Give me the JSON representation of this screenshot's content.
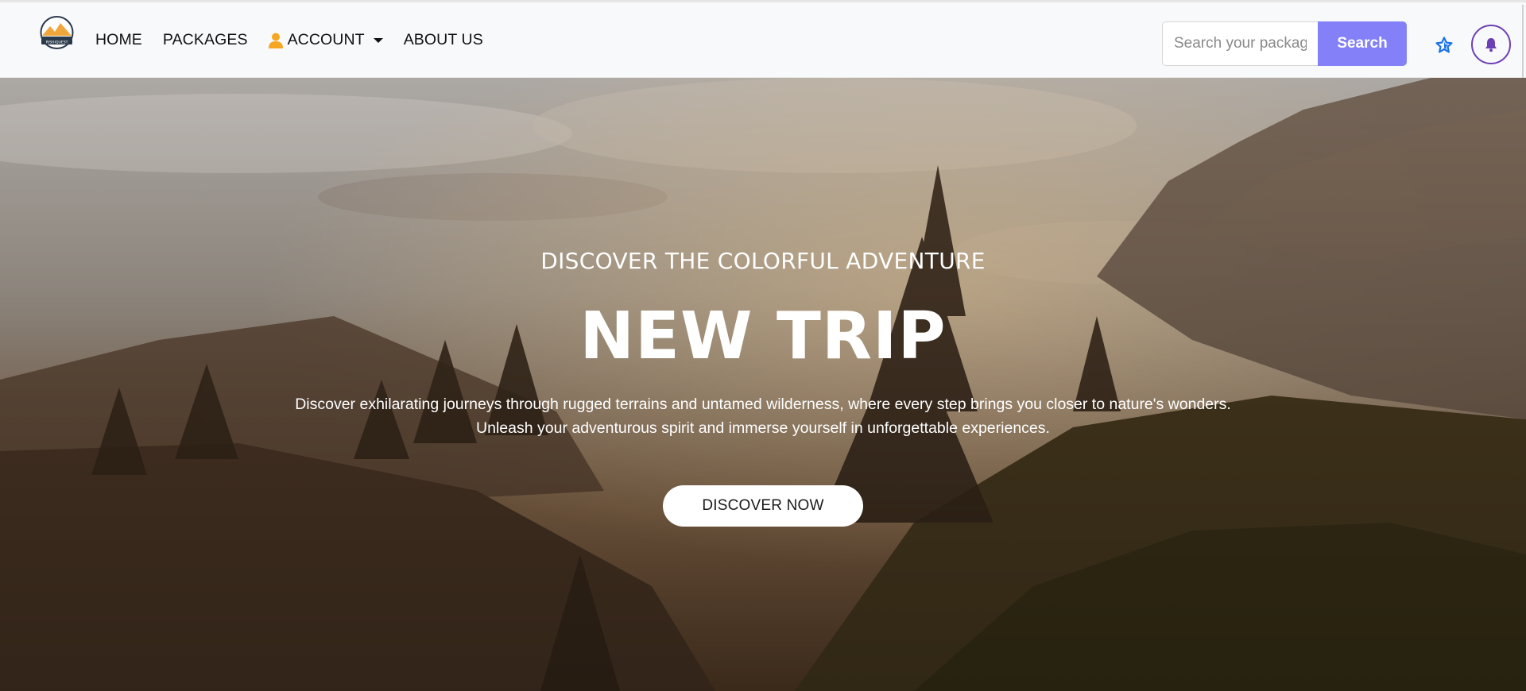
{
  "navbar": {
    "logo_text": "RISHIQUEST",
    "links": [
      "HOME",
      "PACKAGES",
      "ACCOUNT",
      "ABOUT US"
    ],
    "search": {
      "placeholder": "Search your packag",
      "button_label": "Search"
    }
  },
  "hero": {
    "subtitle": "DISCOVER THE COLORFUL ADVENTURE",
    "title": "NEW TRIP",
    "description_line1": "Discover exhilarating journeys through rugged terrains and untamed wilderness, where every step brings you closer to nature's wonders.",
    "description_line2": "Unleash your adventurous spirit and immerse yourself in unforgettable experiences.",
    "cta_label": "DISCOVER NOW"
  },
  "colors": {
    "accent": "#8481f8",
    "account_icon": "#f5a623",
    "star_icon": "#1a73e8",
    "bell": "#6d3fb5"
  },
  "icons": [
    "logo",
    "user-icon",
    "caret-down-icon",
    "star-icon",
    "bell-icon"
  ]
}
